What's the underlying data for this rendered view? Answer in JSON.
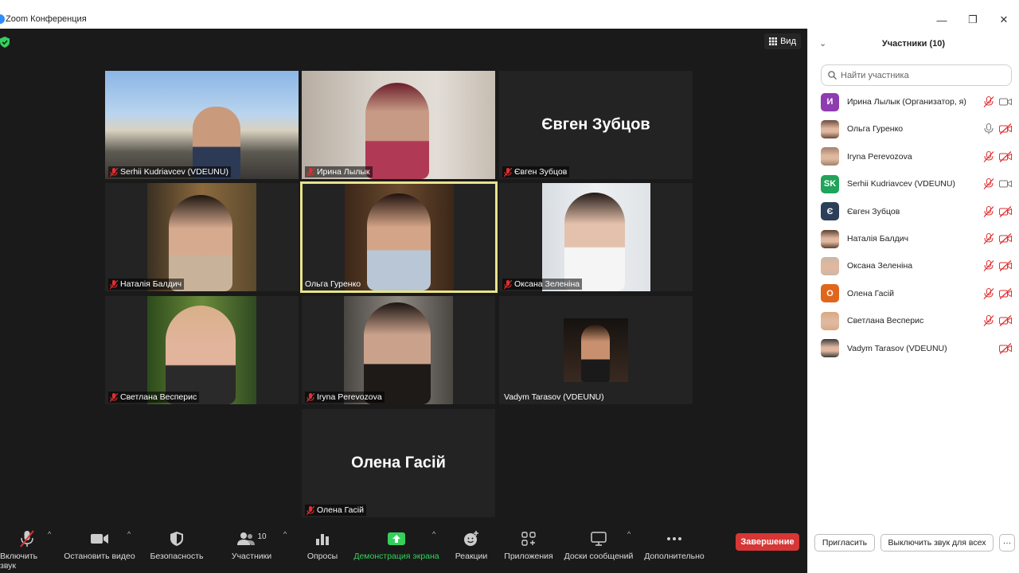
{
  "window": {
    "title": "Zoom Конференция",
    "minimize": "—",
    "maximize": "❐",
    "close": "✕"
  },
  "view_button": "Вид",
  "colors": {
    "accent_green": "#33d15c",
    "end_red": "#d63636",
    "active_border": "#e8e48a",
    "muted_red": "#e02f2f"
  },
  "tiles": [
    {
      "label": "Serhii Kudriavcev (VDEUNU)",
      "center": ""
    },
    {
      "label": "Ирина Лылык",
      "center": ""
    },
    {
      "label": "Євген Зубцов",
      "center": "Євген Зубцов"
    },
    {
      "label": "Наталія Балдич",
      "center": ""
    },
    {
      "label": "Ольга Гуренко",
      "center": ""
    },
    {
      "label": "Оксана Зеленіна",
      "center": ""
    },
    {
      "label": "Светлана Весперис",
      "center": ""
    },
    {
      "label": "Iryna Perevozova",
      "center": ""
    },
    {
      "label": "Vadym Tarasov (VDEUNU)",
      "center": ""
    },
    {
      "label": "Олена Гасій",
      "center": "Олена Гасій"
    }
  ],
  "toolbar": {
    "unmute": "Включить звук",
    "stop_video": "Остановить видео",
    "security": "Безопасность",
    "participants": "Участники",
    "participants_count": "10",
    "polls": "Опросы",
    "share_screen": "Демонстрация экрана",
    "reactions": "Реакции",
    "apps": "Приложения",
    "whiteboards": "Доски сообщений",
    "more": "Дополнительно",
    "end": "Завершение"
  },
  "panel": {
    "title": "Участники (10)",
    "search_placeholder": "Найти участника",
    "participants": [
      {
        "name": "Ирина Лылык (Организатор, я)",
        "initial": "И",
        "avatar_color": "#8e3cb0"
      },
      {
        "name": "Ольга Гуренко",
        "initial": "",
        "avatar_color": "#6b4a3a"
      },
      {
        "name": "Iryna Perevozova",
        "initial": "",
        "avatar_color": "#a0806a"
      },
      {
        "name": "Serhii Kudriavcev (VDEUNU)",
        "initial": "SK",
        "avatar_color": "#20a35a"
      },
      {
        "name": "Євген Зубцов",
        "initial": "Є",
        "avatar_color": "#2c3e58"
      },
      {
        "name": "Наталія Балдич",
        "initial": "",
        "avatar_color": "#5a4030"
      },
      {
        "name": "Оксана Зеленіна",
        "initial": "",
        "avatar_color": "#c9b8a8"
      },
      {
        "name": "Олена Гасій",
        "initial": "О",
        "avatar_color": "#e0661c"
      },
      {
        "name": "Светлана Весперис",
        "initial": "",
        "avatar_color": "#d9a880"
      },
      {
        "name": "Vadym Tarasov (VDEUNU)",
        "initial": "",
        "avatar_color": "#3a3a3a"
      }
    ],
    "invite": "Пригласить",
    "mute_all": "Выключить звук для всех",
    "more": "···"
  }
}
